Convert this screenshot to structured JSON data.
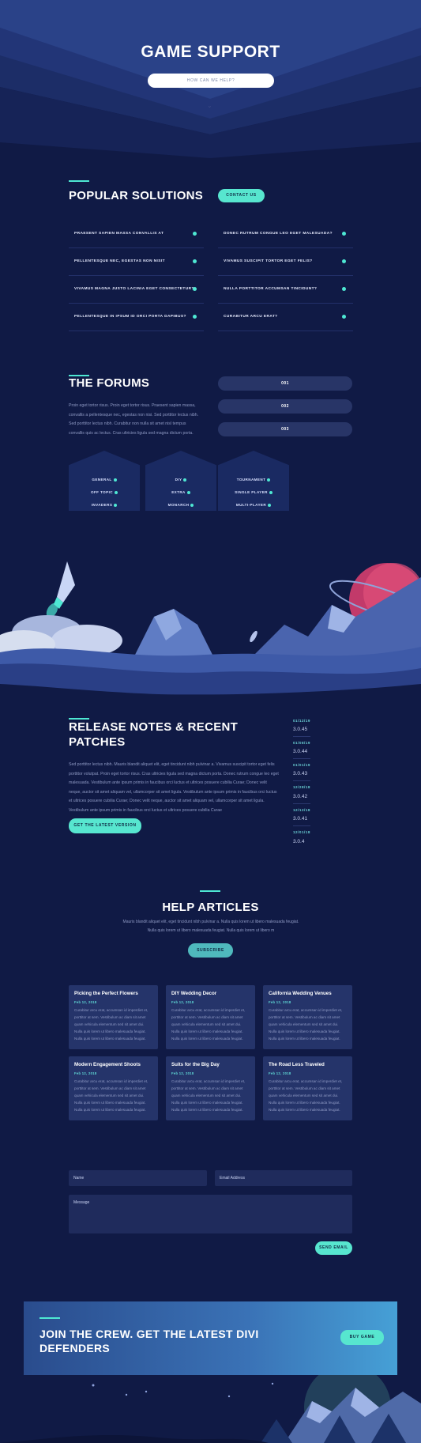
{
  "hero": {
    "title": "GAME SUPPORT",
    "search_placeholder": "HOW CAN WE HELP?",
    "chevron_icon": "chevron-down-icon"
  },
  "solutions": {
    "title": "POPULAR SOLUTIONS",
    "contact_label": "CONTACT US",
    "items": [
      "PRAESENT SAPIEN MASSA CONVALLIS AT",
      "DONEC RUTRUM CONGUE LEO EGET MALESUADA?",
      "PELLENTESQUE NEC, EGESTAS NON NISIT",
      "VIVAMUS SUSCIPIT TORTOR EGET FELIS?",
      "VIVAMUS MAGNA JUSTO LACINIA EGET CONSECTETUR?",
      "NULLA PORTTITOR ACCUMSAN TINCIDUNT?",
      "PELLENTESQUE IN IPSUM ID ORCI PORTA DAPIBUS?",
      "CURABITUR ARCU ERAT?"
    ]
  },
  "forums": {
    "title": "THE FORUMS",
    "text": "Proin eget tortor risus. Proin eget tortor risus. Praesent sapien massa, convallis a pellentesque nec, egestas non nisi. Sed porttitor lectus nibh. Sed porttitor lectus nibh. Curabitur non nulla sit amet nisl tempus convallis quis ac lectus. Cras ultricies ligula sed magna dictum porta.",
    "pills": [
      "001",
      "002",
      "003"
    ],
    "houses": [
      [
        "GENERAL",
        "OFF TOPIC",
        "INVADERS"
      ],
      [
        "DIY",
        "EXTRA",
        "MONARCH"
      ],
      [
        "TOURNAMENT",
        "SINGLE PLAYER",
        "MULTI-PLAYER"
      ]
    ]
  },
  "release": {
    "title": "RELEASE NOTES & RECENT PATCHES",
    "text": "Sed porttitor lectus nibh. Mauris blandit aliquet elit, eget tincidunt nibh pulvinar a. Vivamus suscipit tortor eget felis porttitor volutpat. Proin eget tortor risus. Cras ultricies ligula sed magna dictum porta. Donec rutrum congue leo eget malesuada. Vestibulum ante ipsum primis in faucibus orci luctus et ultrices posuere cubilia Curae; Donec velit neque, auctor sit amet aliquam vel, ullamcorper sit amet ligula. Vestibulum ante ipsum primis in faucibus orci luctus et ultrices posuere cubilia Curae; Donec velit neque, auctor sit amet aliquam vel, ullamcorper sit amet ligula. Vestibulum ante ipsum primis in faucibus orci luctus et ultrices posuere cubilia Curae",
    "button_label": "GET THE LATEST VERSION",
    "versions": [
      {
        "date": "01/12/19",
        "num": "3.0.45"
      },
      {
        "date": "01/08/19",
        "num": "3.0.44"
      },
      {
        "date": "01/01/19",
        "num": "3.0.43"
      },
      {
        "date": "12/28/18",
        "num": "3.0.42"
      },
      {
        "date": "12/12/18",
        "num": "3.0.41"
      },
      {
        "date": "12/01/18",
        "num": "3.0.4"
      }
    ]
  },
  "help": {
    "title": "HELP ARTICLES",
    "text": "Mauris blandit aliquet elit, eget tincidunt nibh pulvinar a. Nulla quis lorem ut libero malesuada feugiat. Nulla quis lorem ut libero malesuada feugiat. Nulla quis lorem ut libero m",
    "subscribe_label": "SUBSCRIBE",
    "card_text": "Curabitur arcu erat, accumsan id imperdiet et, porttitor at sem. Vestibulum ac diam sit amet quam vehicula elementum sed sit amet dui. Nulla quis lorem ut libero malesuada feugiat. Nulla quis lorem ut libero malesuada feugiat.",
    "cards": [
      {
        "title": "Picking the Perfect Flowers",
        "date": "Feb 12, 2018"
      },
      {
        "title": "DIY Wedding Decor",
        "date": "Feb 12, 2018"
      },
      {
        "title": "California Wedding Venues",
        "date": "Feb 12, 2018"
      },
      {
        "title": "Modern Engagement Shoots",
        "date": "Feb 12, 2018"
      },
      {
        "title": "Suits for the Big Day",
        "date": "Feb 12, 2018"
      },
      {
        "title": "The Road Less Traveled",
        "date": "Feb 12, 2018"
      }
    ]
  },
  "form": {
    "name_placeholder": "Name",
    "email_placeholder": "Email Address",
    "message_placeholder": "Message",
    "send_label": "SEND EMAIL"
  },
  "cta": {
    "title": "JOIN THE CREW. GET THE LATEST DIVI DEFENDERS",
    "button_label": "BUY GAME"
  },
  "colors": {
    "background": "#101a45",
    "accent": "#57e6cf",
    "card": "#25346a"
  }
}
